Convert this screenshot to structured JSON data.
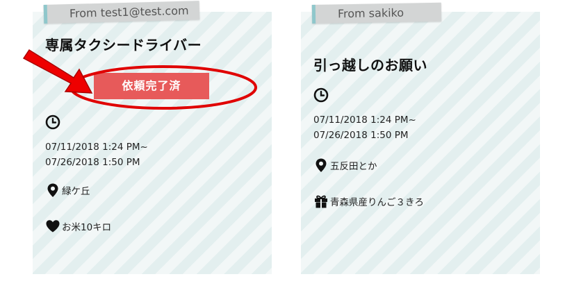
{
  "cards": [
    {
      "from": "From test1@test.com",
      "title": "専属タクシードライバー",
      "status_button": "依頼完了済",
      "date_start": "07/11/2018 1:24 PM~",
      "date_end": "07/26/2018 1:50 PM",
      "location": "緑ケ丘",
      "reward": "お米10キロ",
      "icons": [
        "clock-icon",
        "location-pin-icon",
        "heart-icon"
      ]
    },
    {
      "from": "From sakiko",
      "title": "引っ越しのお願い",
      "date_start": "07/11/2018 1:24 PM~",
      "date_end": "07/26/2018 1:50 PM",
      "location": "五反田とか",
      "reward": "青森県産りんご３きろ",
      "icons": [
        "clock-icon",
        "location-pin-icon",
        "gift-icon"
      ]
    }
  ],
  "colors": {
    "status_button": "#e75a5a",
    "annotation": "#e00000",
    "tag_accent": "#8fc7cb"
  }
}
